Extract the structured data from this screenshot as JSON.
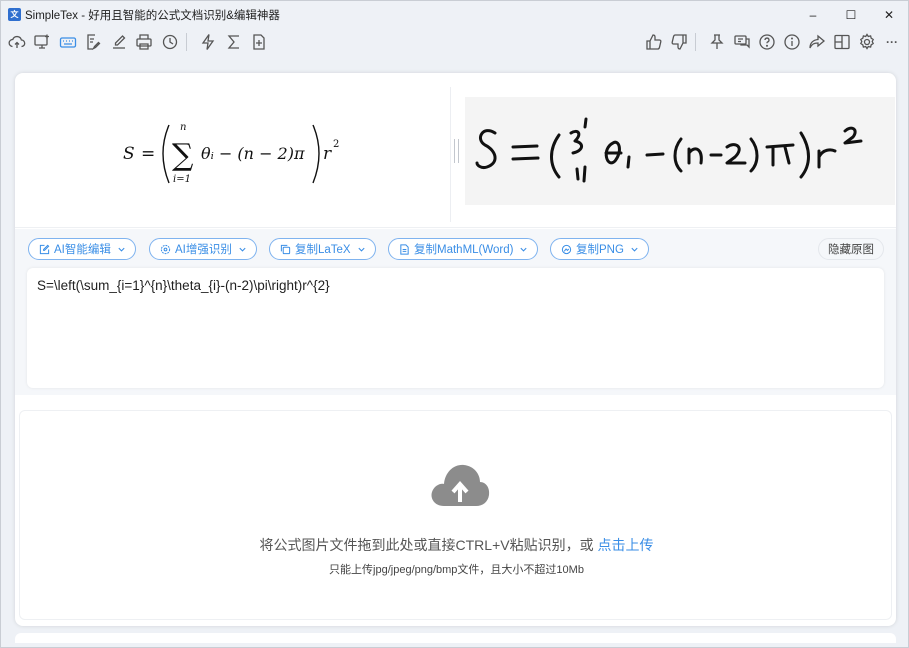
{
  "window": {
    "logo_text": "文",
    "title": "SimpleTex - 好用且智能的公式文档识别&编辑神器",
    "minimize": "–",
    "maximize": "☐",
    "close": "✕"
  },
  "toolbar": {
    "left_icons": [
      "cloud-upload-icon",
      "screen-capture-icon",
      "keyboard-icon",
      "document-edit-icon",
      "handwriting-icon",
      "printer-icon",
      "history-icon"
    ],
    "mid_icons": [
      "lightning-icon",
      "sigma-icon",
      "document-add-icon"
    ],
    "right_icons": [
      "thumbs-up-icon",
      "thumbs-down-icon",
      "pin-icon",
      "chat-icon",
      "help-icon",
      "info-icon",
      "share-icon",
      "layout-icon",
      "settings-icon",
      "more-icon"
    ],
    "active_icon": "keyboard-icon",
    "more_glyph": "···"
  },
  "preview": {
    "rendered_formula": {
      "lhs": "S",
      "eq": "=",
      "sum_upper": "n",
      "sum_lower": "i=1",
      "body": "θᵢ − (n − 2)π",
      "rhs": "r",
      "exp": "2"
    },
    "handwritten_image": "S = (Σ θi − (n−2)π) r²"
  },
  "actions": {
    "ai_edit": "AI智能编辑",
    "ai_enhance": "AI增强识别",
    "copy_latex": "复制LaTeX",
    "copy_mathml": "复制MathML(Word)",
    "copy_png": "复制PNG",
    "hide_original": "隐藏原图"
  },
  "latex_source": "S=\\left(\\sum_{i=1}^{n}\\theta_{i}-(n-2)\\pi\\right)r^{2}",
  "upload": {
    "hint_prefix": "将公式图片文件拖到此处或直接CTRL+V粘贴识别，或",
    "hint_link": "点击上传",
    "sub_hint": "只能上传jpg/jpeg/png/bmp文件，且大小不超过10Mb"
  },
  "colors": {
    "accent": "#3a8ee6",
    "background": "#eef1f6",
    "card": "#ffffff"
  }
}
